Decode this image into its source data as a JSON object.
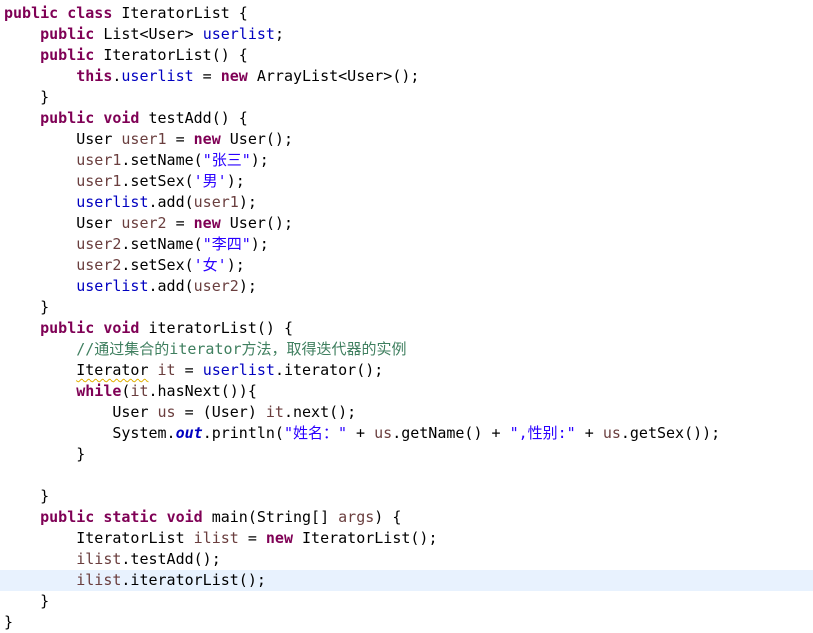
{
  "editor": {
    "current_line_color": "#e8f2fe",
    "syntax_colors": {
      "keyword": "#7f0055",
      "field": "#0000c0",
      "local_variable": "#6a3e3e",
      "string": "#2a00ff",
      "comment": "#3f7f5f"
    },
    "current_line_index": 27,
    "lines": [
      [
        {
          "t": "public",
          "c": "kw"
        },
        {
          "t": " "
        },
        {
          "t": "class",
          "c": "kw"
        },
        {
          "t": " IteratorList {"
        }
      ],
      [
        {
          "t": "    "
        },
        {
          "t": "public",
          "c": "kw"
        },
        {
          "t": " List<User> "
        },
        {
          "t": "userlist",
          "c": "fld"
        },
        {
          "t": ";"
        }
      ],
      [
        {
          "t": "    "
        },
        {
          "t": "public",
          "c": "kw"
        },
        {
          "t": " IteratorList() {"
        }
      ],
      [
        {
          "t": "        "
        },
        {
          "t": "this",
          "c": "kw"
        },
        {
          "t": "."
        },
        {
          "t": "userlist",
          "c": "fld"
        },
        {
          "t": " = "
        },
        {
          "t": "new",
          "c": "kw"
        },
        {
          "t": " ArrayList<User>();"
        }
      ],
      [
        {
          "t": "    }"
        }
      ],
      [
        {
          "t": "    "
        },
        {
          "t": "public",
          "c": "kw"
        },
        {
          "t": " "
        },
        {
          "t": "void",
          "c": "kw"
        },
        {
          "t": " testAdd() {"
        }
      ],
      [
        {
          "t": "        User "
        },
        {
          "t": "user1",
          "c": "var"
        },
        {
          "t": " = "
        },
        {
          "t": "new",
          "c": "kw"
        },
        {
          "t": " User();"
        }
      ],
      [
        {
          "t": "        "
        },
        {
          "t": "user1",
          "c": "var"
        },
        {
          "t": ".setName("
        },
        {
          "t": "\"张三\"",
          "c": "str"
        },
        {
          "t": ");"
        }
      ],
      [
        {
          "t": "        "
        },
        {
          "t": "user1",
          "c": "var"
        },
        {
          "t": ".setSex("
        },
        {
          "t": "'男'",
          "c": "str"
        },
        {
          "t": ");"
        }
      ],
      [
        {
          "t": "        "
        },
        {
          "t": "userlist",
          "c": "fld"
        },
        {
          "t": ".add("
        },
        {
          "t": "user1",
          "c": "var"
        },
        {
          "t": ");"
        }
      ],
      [
        {
          "t": "        User "
        },
        {
          "t": "user2",
          "c": "var"
        },
        {
          "t": " = "
        },
        {
          "t": "new",
          "c": "kw"
        },
        {
          "t": " User();"
        }
      ],
      [
        {
          "t": "        "
        },
        {
          "t": "user2",
          "c": "var"
        },
        {
          "t": ".setName("
        },
        {
          "t": "\"李四\"",
          "c": "str"
        },
        {
          "t": ");"
        }
      ],
      [
        {
          "t": "        "
        },
        {
          "t": "user2",
          "c": "var"
        },
        {
          "t": ".setSex("
        },
        {
          "t": "'女'",
          "c": "str"
        },
        {
          "t": ");"
        }
      ],
      [
        {
          "t": "        "
        },
        {
          "t": "userlist",
          "c": "fld"
        },
        {
          "t": ".add("
        },
        {
          "t": "user2",
          "c": "var"
        },
        {
          "t": ");"
        }
      ],
      [
        {
          "t": "    }"
        }
      ],
      [
        {
          "t": "    "
        },
        {
          "t": "public",
          "c": "kw"
        },
        {
          "t": " "
        },
        {
          "t": "void",
          "c": "kw"
        },
        {
          "t": " iteratorList() {"
        }
      ],
      [
        {
          "t": "        "
        },
        {
          "t": "//通过集合的iterator方法，取得迭代器的实例",
          "c": "cmt"
        }
      ],
      [
        {
          "t": "        "
        },
        {
          "t": "Iterator",
          "c": "warn"
        },
        {
          "t": " "
        },
        {
          "t": "it",
          "c": "var"
        },
        {
          "t": " = "
        },
        {
          "t": "userlist",
          "c": "fld"
        },
        {
          "t": ".iterator();"
        }
      ],
      [
        {
          "t": "        "
        },
        {
          "t": "while",
          "c": "kw"
        },
        {
          "t": "("
        },
        {
          "t": "it",
          "c": "var"
        },
        {
          "t": ".hasNext()){"
        }
      ],
      [
        {
          "t": "            User "
        },
        {
          "t": "us",
          "c": "var"
        },
        {
          "t": " = (User) "
        },
        {
          "t": "it",
          "c": "var"
        },
        {
          "t": ".next();"
        }
      ],
      [
        {
          "t": "            System."
        },
        {
          "t": "out",
          "c": "sfld"
        },
        {
          "t": ".println("
        },
        {
          "t": "\"姓名：\"",
          "c": "str"
        },
        {
          "t": " + "
        },
        {
          "t": "us",
          "c": "var"
        },
        {
          "t": ".getName() + "
        },
        {
          "t": "\",性别:\"",
          "c": "str"
        },
        {
          "t": " + "
        },
        {
          "t": "us",
          "c": "var"
        },
        {
          "t": ".getSex());"
        }
      ],
      [
        {
          "t": "        }"
        }
      ],
      [
        {
          "t": ""
        }
      ],
      [
        {
          "t": "    }"
        }
      ],
      [
        {
          "t": "    "
        },
        {
          "t": "public",
          "c": "kw"
        },
        {
          "t": " "
        },
        {
          "t": "static",
          "c": "kw"
        },
        {
          "t": " "
        },
        {
          "t": "void",
          "c": "kw"
        },
        {
          "t": " main(String[] "
        },
        {
          "t": "args",
          "c": "var"
        },
        {
          "t": ") {"
        }
      ],
      [
        {
          "t": "        IteratorList "
        },
        {
          "t": "ilist",
          "c": "var"
        },
        {
          "t": " = "
        },
        {
          "t": "new",
          "c": "kw"
        },
        {
          "t": " IteratorList();"
        }
      ],
      [
        {
          "t": "        "
        },
        {
          "t": "ilist",
          "c": "var"
        },
        {
          "t": ".testAdd();"
        }
      ],
      [
        {
          "t": "        "
        },
        {
          "t": "ilist",
          "c": "var"
        },
        {
          "t": ".iteratorList();"
        }
      ],
      [
        {
          "t": "    }"
        }
      ],
      [
        {
          "t": "}"
        }
      ]
    ]
  }
}
